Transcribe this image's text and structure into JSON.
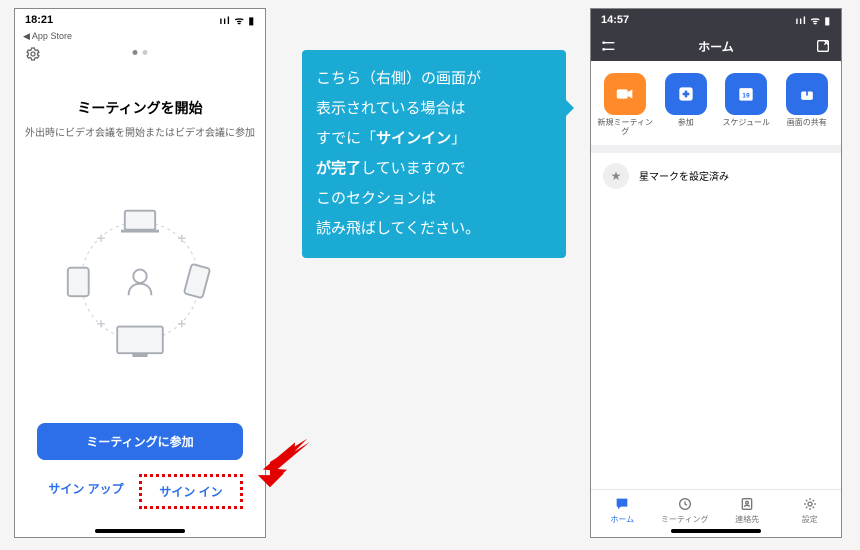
{
  "left": {
    "time": "18:21",
    "appstore": "◀ App Store",
    "title": "ミーティングを開始",
    "subtitle": "外出時にビデオ会議を開始またはビデオ会議に参加",
    "join": "ミーティングに参加",
    "signup": "サイン アップ",
    "signin": "サイン イン"
  },
  "right": {
    "time": "14:57",
    "title": "ホーム",
    "actions": [
      {
        "label": "新規ミーティング",
        "color": "orange",
        "icon": "video"
      },
      {
        "label": "参加",
        "color": "blue",
        "icon": "plus"
      },
      {
        "label": "スケジュール",
        "color": "blue",
        "icon": "calendar"
      },
      {
        "label": "画面の共有",
        "color": "blue",
        "icon": "share"
      }
    ],
    "star_text": "星マークを設定済み",
    "tabs": [
      {
        "label": "ホーム",
        "icon": "chat",
        "active": true
      },
      {
        "label": "ミーティング",
        "icon": "clock",
        "active": false
      },
      {
        "label": "連絡先",
        "icon": "contacts",
        "active": false
      },
      {
        "label": "設定",
        "icon": "gear",
        "active": false
      }
    ]
  },
  "callout": {
    "l1": "こちら（右側）の画面が",
    "l2": "表示されている場合は",
    "l3a": "すでに「",
    "l3b": "サインイン",
    "l3c": "」",
    "l4a": "が完了",
    "l4b": "していますので",
    "l5": "このセクションは",
    "l6": "読み飛ばしてください。"
  }
}
